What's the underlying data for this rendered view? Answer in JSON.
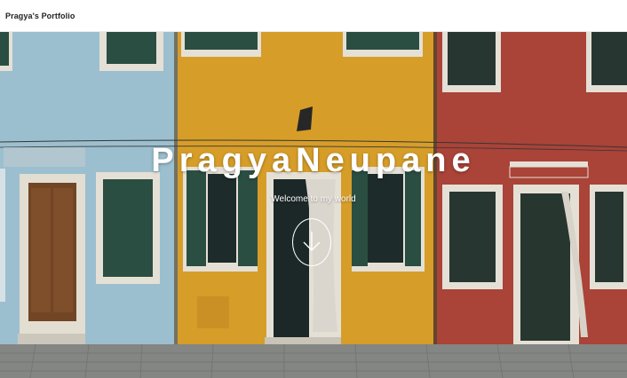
{
  "navbar": {
    "brand": "Pragya's Portfolio"
  },
  "hero": {
    "title": "PragyaNeupane",
    "subtitle": "Welcome to my world",
    "scroll_icon": "arrow-down-icon"
  },
  "colors": {
    "house_blue": "#a9cfe0",
    "house_yellow": "#e4a72c",
    "house_red": "#b5483c",
    "shutter_green": "#2f5a48",
    "pavement": "#8d8f8c"
  }
}
